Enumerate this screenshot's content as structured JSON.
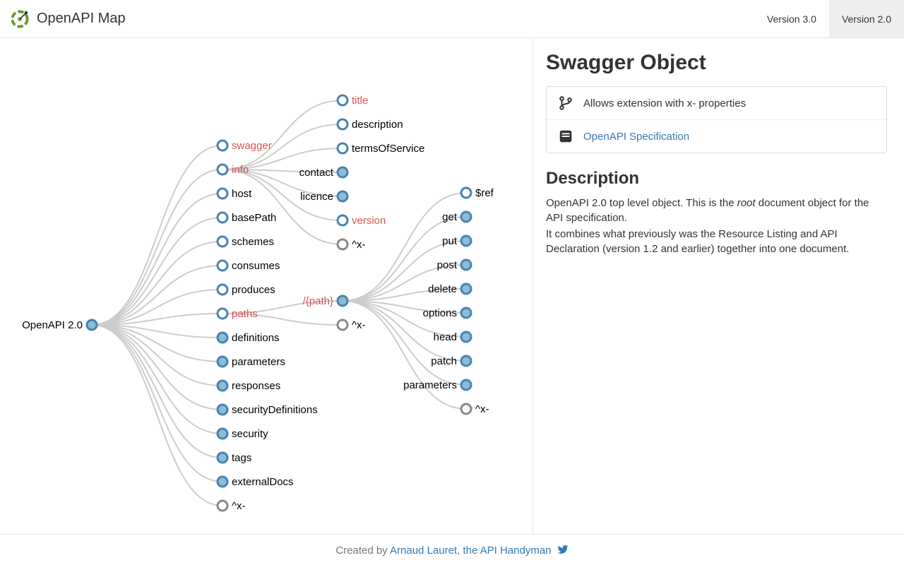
{
  "header": {
    "title": "OpenAPI Map",
    "tabs": [
      {
        "label": "Version 3.0",
        "active": false
      },
      {
        "label": "Version 2.0",
        "active": true
      }
    ]
  },
  "detail": {
    "title": "Swagger Object",
    "extension_text": "Allows extension with x- properties",
    "spec_link_text": "OpenAPI Specification",
    "desc_heading": "Description",
    "desc_line1_a": "OpenAPI 2.0 top level object. This is the ",
    "desc_line1_em": "root",
    "desc_line1_b": " document object for the API specification.",
    "desc_line2": "It combines what previously was the Resource Listing and API Declaration (version 1.2 and earlier) together into one document."
  },
  "footer": {
    "prefix": "Created by ",
    "link_text": "Arnaud Lauret, the API Handyman"
  },
  "map": {
    "root": "OpenAPI 2.0",
    "level1": [
      {
        "label": "swagger",
        "red": true,
        "leaf": false,
        "children": false
      },
      {
        "label": "info",
        "red": true,
        "leaf": false,
        "children": true
      },
      {
        "label": "host",
        "red": false,
        "leaf": false,
        "children": false
      },
      {
        "label": "basePath",
        "red": false,
        "leaf": false,
        "children": false
      },
      {
        "label": "schemes",
        "red": false,
        "leaf": false,
        "children": false
      },
      {
        "label": "consumes",
        "red": false,
        "leaf": false,
        "children": false
      },
      {
        "label": "produces",
        "red": false,
        "leaf": false,
        "children": false
      },
      {
        "label": "paths",
        "red": true,
        "leaf": false,
        "children": true
      },
      {
        "label": "definitions",
        "red": false,
        "leaf": true,
        "children": false
      },
      {
        "label": "parameters",
        "red": false,
        "leaf": true,
        "children": false
      },
      {
        "label": "responses",
        "red": false,
        "leaf": true,
        "children": false
      },
      {
        "label": "securityDefinitions",
        "red": false,
        "leaf": true,
        "children": false
      },
      {
        "label": "security",
        "red": false,
        "leaf": true,
        "children": false
      },
      {
        "label": "tags",
        "red": false,
        "leaf": true,
        "children": false
      },
      {
        "label": "externalDocs",
        "red": false,
        "leaf": true,
        "children": false
      },
      {
        "label": "^x-",
        "red": false,
        "leaf": false,
        "grey": true,
        "children": false
      }
    ],
    "info_children": [
      {
        "label": "title",
        "red": true,
        "leaf": false
      },
      {
        "label": "description",
        "red": false,
        "leaf": false
      },
      {
        "label": "termsOfService",
        "red": false,
        "leaf": false
      },
      {
        "label": "contact",
        "red": false,
        "leaf": true,
        "side": "left"
      },
      {
        "label": "licence",
        "red": false,
        "leaf": true,
        "side": "left"
      },
      {
        "label": "version",
        "red": true,
        "leaf": false
      },
      {
        "label": "^x-",
        "red": false,
        "leaf": false,
        "grey": true
      }
    ],
    "paths_children": [
      {
        "label": "/{path}",
        "red": true,
        "leaf": true,
        "side": "left",
        "children": true
      },
      {
        "label": "^x-",
        "red": false,
        "leaf": false,
        "grey": true
      }
    ],
    "path_children": [
      {
        "label": "$ref",
        "red": false,
        "leaf": false
      },
      {
        "label": "get",
        "red": false,
        "leaf": true,
        "side": "left"
      },
      {
        "label": "put",
        "red": false,
        "leaf": true,
        "side": "left"
      },
      {
        "label": "post",
        "red": false,
        "leaf": true,
        "side": "left"
      },
      {
        "label": "delete",
        "red": false,
        "leaf": true,
        "side": "left"
      },
      {
        "label": "options",
        "red": false,
        "leaf": true,
        "side": "left"
      },
      {
        "label": "head",
        "red": false,
        "leaf": true,
        "side": "left"
      },
      {
        "label": "patch",
        "red": false,
        "leaf": true,
        "side": "left"
      },
      {
        "label": "parameters",
        "red": false,
        "leaf": true,
        "side": "left"
      },
      {
        "label": "^x-",
        "red": false,
        "leaf": false,
        "grey": true
      }
    ]
  }
}
